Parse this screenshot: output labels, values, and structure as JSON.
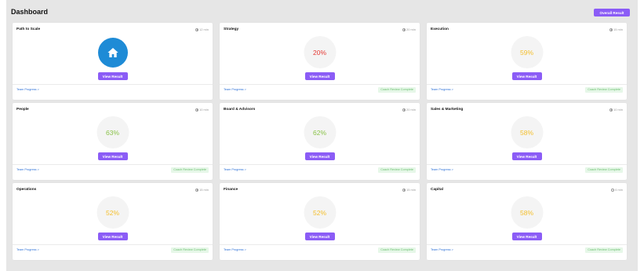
{
  "header": {
    "title": "Dashboard",
    "overall_button": "Overall Result"
  },
  "colors": {
    "accent": "#8b5cf6",
    "link": "#2b6fd6",
    "badge_bg": "#e6f7e8",
    "badge_text": "#6cc070",
    "pct_red": "#e53935",
    "pct_yellow": "#f4bf2b",
    "pct_green": "#8bc34a",
    "home_circle": "#1e8bd6"
  },
  "cards": [
    {
      "title": "Path to Scale",
      "time": "12 min",
      "value": "",
      "icon": "home-icon",
      "value_color": "",
      "button": "View Result",
      "team_link": "Team Progress >",
      "badge": ""
    },
    {
      "title": "Strategy",
      "time": "20 min",
      "value": "20%",
      "icon": "",
      "value_color": "red",
      "button": "View Result",
      "team_link": "Team Progress >",
      "badge": "Coach Review Complete"
    },
    {
      "title": "Execution",
      "time": "15 min",
      "value": "59%",
      "icon": "",
      "value_color": "yellow",
      "button": "View Result",
      "team_link": "Team Progress >",
      "badge": "Coach Review Complete"
    },
    {
      "title": "People",
      "time": "10 min",
      "value": "63%",
      "icon": "",
      "value_color": "green",
      "button": "View Result",
      "team_link": "Team Progress >",
      "badge": "Coach Review Complete"
    },
    {
      "title": "Board & Advisors",
      "time": "20 min",
      "value": "62%",
      "icon": "",
      "value_color": "green",
      "button": "View Result",
      "team_link": "Team Progress >",
      "badge": "Coach Review Complete"
    },
    {
      "title": "Sales & Marketing",
      "time": "10 min",
      "value": "58%",
      "icon": "",
      "value_color": "yellow",
      "button": "View Result",
      "team_link": "Team Progress >",
      "badge": "Coach Review Complete"
    },
    {
      "title": "Operations",
      "time": "15 min",
      "value": "52%",
      "icon": "",
      "value_color": "yellow",
      "button": "View Result",
      "team_link": "Team Progress >",
      "badge": "Coach Review Complete"
    },
    {
      "title": "Finance",
      "time": "15 min",
      "value": "52%",
      "icon": "",
      "value_color": "yellow",
      "button": "View Result",
      "team_link": "Team Progress >",
      "badge": "Coach Review Complete"
    },
    {
      "title": "Capital",
      "time": "6 min",
      "value": "58%",
      "icon": "",
      "value_color": "yellow",
      "button": "View Result",
      "team_link": "Team Progress >",
      "badge": "Coach Review Complete"
    }
  ]
}
